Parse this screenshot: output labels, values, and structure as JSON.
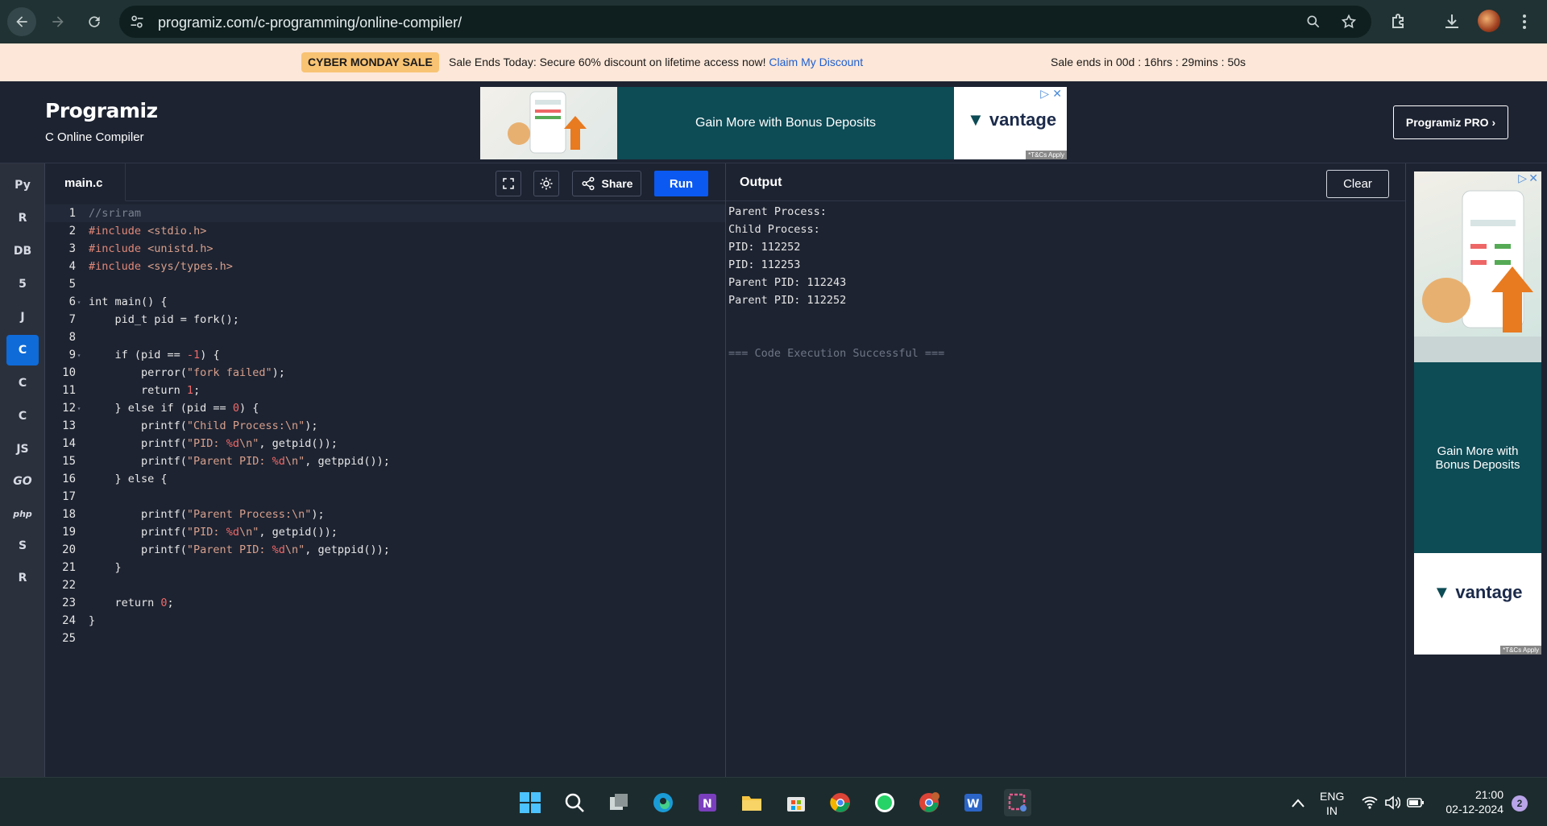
{
  "browser": {
    "url": "programiz.com/c-programming/online-compiler/"
  },
  "sale_banner": {
    "badge": "CYBER MONDAY SALE",
    "text": "Sale Ends Today: Secure 60% discount on lifetime access now!",
    "link": "Claim My Discount",
    "countdown": "Sale ends in 00d : 16hrs : 29mins : 50s"
  },
  "header": {
    "logo": "Programiz",
    "subtitle": "C Online Compiler",
    "pro_button": "Programiz PRO ›"
  },
  "ad_top": {
    "headline": "Gain More with Bonus Deposits",
    "brand": "vantage",
    "tc": "*T&Cs Apply"
  },
  "languages": [
    {
      "icon": "python-icon",
      "glyph": "Py",
      "active": false
    },
    {
      "icon": "r-icon",
      "glyph": "R",
      "active": false
    },
    {
      "icon": "sql-icon",
      "glyph": "DB",
      "active": false
    },
    {
      "icon": "html-icon",
      "glyph": "5",
      "active": false
    },
    {
      "icon": "java-icon",
      "glyph": "J",
      "active": false
    },
    {
      "icon": "c-icon",
      "glyph": "C",
      "active": true
    },
    {
      "icon": "cpp-icon",
      "glyph": "C",
      "active": false
    },
    {
      "icon": "csharp-icon",
      "glyph": "C",
      "active": false
    },
    {
      "icon": "javascript-icon",
      "glyph": "JS",
      "active": false
    },
    {
      "icon": "go-icon",
      "glyph": "GO",
      "active": false
    },
    {
      "icon": "php-icon",
      "glyph": "php",
      "active": false
    },
    {
      "icon": "swift-icon",
      "glyph": "S",
      "active": false
    },
    {
      "icon": "rust-icon",
      "glyph": "R",
      "active": false
    }
  ],
  "editor": {
    "filename": "main.c",
    "share_label": "Share",
    "run_label": "Run",
    "lines": [
      "//sriram",
      "#include <stdio.h>",
      "#include <unistd.h>",
      "#include <sys/types.h>",
      "",
      "int main() {",
      "    pid_t pid = fork();",
      "",
      "    if (pid == -1) {",
      "        perror(\"fork failed\");",
      "        return 1;",
      "    } else if (pid == 0) {",
      "        printf(\"Child Process:\\n\");",
      "        printf(\"PID: %d\\n\", getpid());",
      "        printf(\"Parent PID: %d\\n\", getppid());",
      "    } else {",
      "",
      "        printf(\"Parent Process:\\n\");",
      "        printf(\"PID: %d\\n\", getpid());",
      "        printf(\"Parent PID: %d\\n\", getppid());",
      "    }",
      "",
      "    return 0;",
      "}",
      ""
    ]
  },
  "output": {
    "title": "Output",
    "clear_label": "Clear",
    "lines": [
      "Parent Process:",
      "Child Process:",
      "PID: 112252",
      "PID: 112253",
      "Parent PID: 112243",
      "Parent PID: 112252",
      "",
      "",
      "=== Code Execution Successful ==="
    ]
  },
  "ad_side": {
    "headline": "Gain More with Bonus Deposits",
    "brand": "vantage",
    "tc": "*T&Cs Apply"
  },
  "taskbar": {
    "lang_top": "ENG",
    "lang_bottom": "IN",
    "time": "21:00",
    "date": "02-12-2024",
    "notifications": "2"
  }
}
